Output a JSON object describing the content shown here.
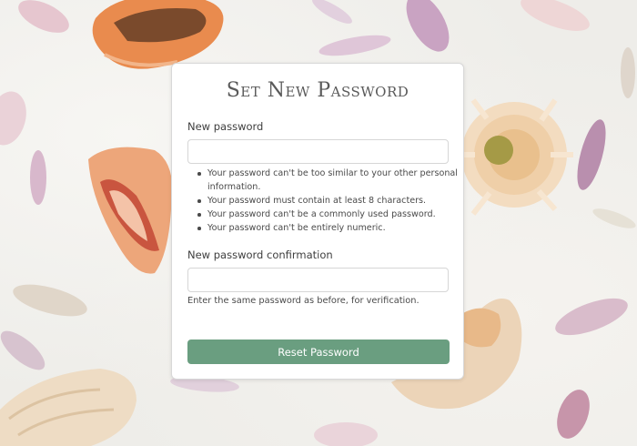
{
  "form": {
    "title": "Set New Password",
    "new_password_label": "New password",
    "new_password_value": "",
    "password_hints": [
      "Your password can't be too similar to your other personal information.",
      "Your password must contain at least 8 characters.",
      "Your password can't be a commonly used password.",
      "Your password can't be entirely numeric."
    ],
    "confirm_label": "New password confirmation",
    "confirm_value": "",
    "confirm_help": "Enter the same password as before, for verification.",
    "submit_label": "Reset Password"
  },
  "colors": {
    "button": "#6a9e80",
    "card_background": "#ffffff",
    "page_background": "#eeede9"
  }
}
